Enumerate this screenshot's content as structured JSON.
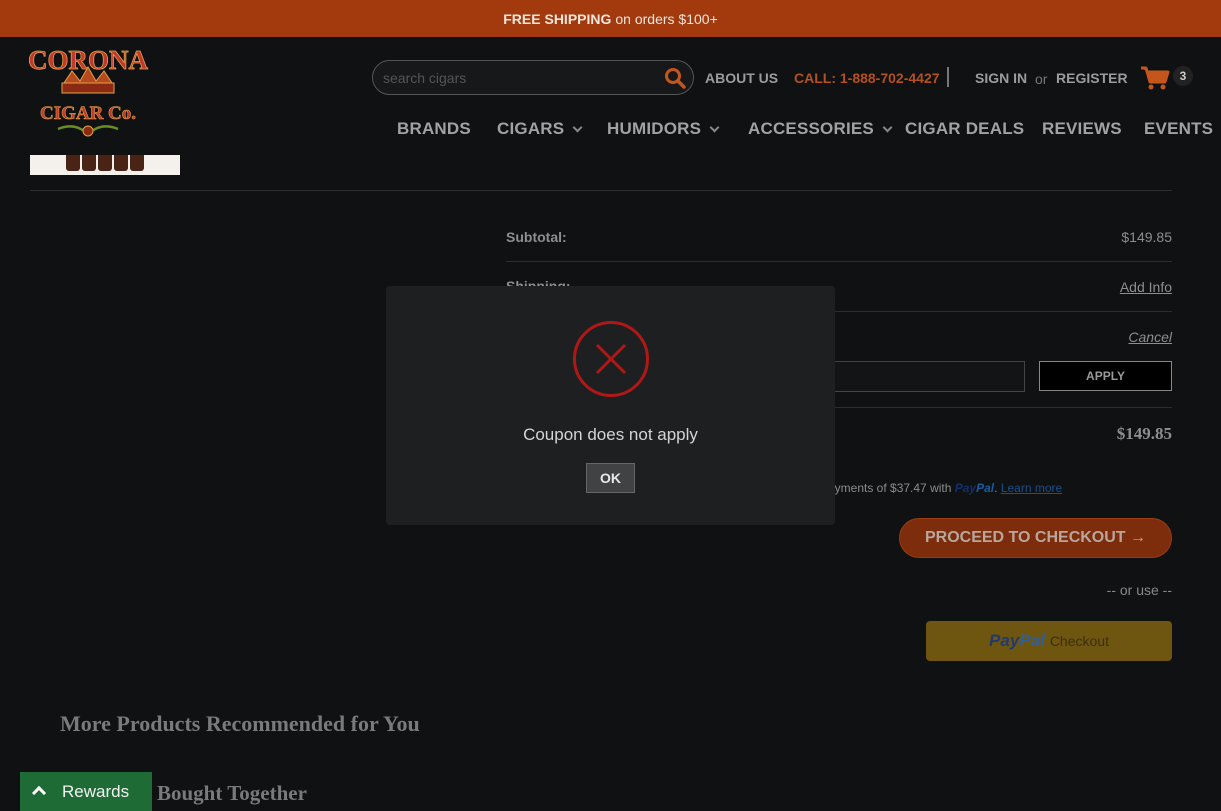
{
  "promo": {
    "bold": "FREE SHIPPING",
    "rest": "on orders $100+"
  },
  "logo": {
    "line1": "CORONA",
    "line2": "CIGAR Co."
  },
  "search": {
    "placeholder": "search cigars"
  },
  "header_links": {
    "about": "ABOUT US",
    "call": "CALL: 1-888-702-4427",
    "sign_in": "SIGN IN",
    "or": "or",
    "register": "REGISTER",
    "cart_count": "3"
  },
  "nav": [
    "BRANDS",
    "CIGARS",
    "HUMIDORS",
    "ACCESSORIES",
    "CIGAR DEALS",
    "REVIEWS",
    "EVENTS"
  ],
  "summary": {
    "subtotal_label": "Subtotal:",
    "subtotal_value": "$149.85",
    "shipping_label": "Shipping:",
    "shipping_link": "Add Info",
    "cancel_link": "Cancel",
    "apply_label": "APPLY",
    "total_value": "$149.85",
    "paylater_text": "ayments of $37.47 with",
    "paylater_brand_a": "Pay",
    "paylater_brand_b": "Pal",
    "paylater_learn": "Learn more"
  },
  "checkout": {
    "proceed_label": "PROCEED TO CHECKOUT →",
    "or_use": "-- or use --",
    "paypal_a": "Pay",
    "paypal_b": "Pal",
    "paypal_checkout": "Checkout"
  },
  "recommendations": {
    "title": "More Products Recommended for You",
    "bought_together": "Bought Together"
  },
  "rewards": {
    "label": "Rewards"
  },
  "dialog": {
    "message": "Coupon does not apply",
    "ok_label": "OK"
  },
  "colors": {
    "promo_bg": "#a33a0e",
    "page_bg": "#0f1112",
    "accent_orange": "#b5501f",
    "checkout_bg": "#7d2c0c",
    "paypal_bg": "#6e5611",
    "rewards_bg": "#1e6b36",
    "error_red": "#b01818",
    "dialog_bg": "#1e1f21"
  },
  "icons": {
    "search": "search-icon",
    "cart": "cart-icon",
    "chevron": "chevron-down-icon",
    "error": "error-x-icon",
    "rewards": "chevron-up-icon"
  }
}
